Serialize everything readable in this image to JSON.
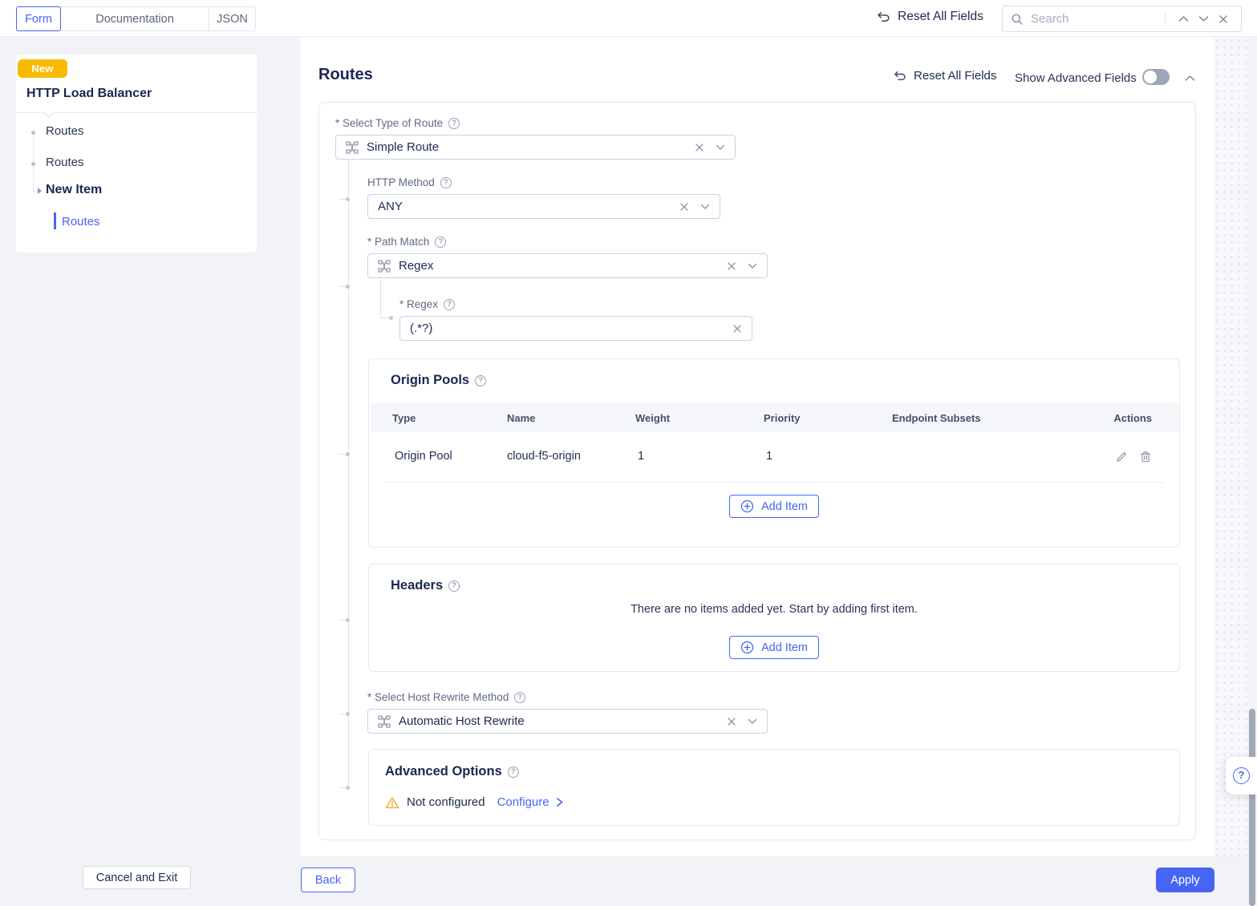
{
  "header": {
    "tabs": {
      "form": "Form",
      "documentation": "Documentation",
      "json": "JSON"
    },
    "reset_all_label": "Reset All Fields",
    "search_placeholder": "Search"
  },
  "sidebar": {
    "badge": "New",
    "title": "HTTP Load Balancer",
    "items": [
      {
        "label": "Routes"
      },
      {
        "label": "Routes"
      },
      {
        "label": "New Item"
      },
      {
        "label": "Routes"
      }
    ]
  },
  "main": {
    "title": "Routes",
    "reset_all_label": "Reset All Fields",
    "advanced_toggle_label": "Show Advanced Fields",
    "route_type": {
      "label": "* Select Type of Route",
      "value": "Simple Route"
    },
    "http_method": {
      "label": "HTTP Method",
      "value": "ANY"
    },
    "path_match": {
      "label": "* Path Match",
      "value": "Regex"
    },
    "regex": {
      "label": "* Regex",
      "value": "(.*?)"
    },
    "origin_pools": {
      "title": "Origin Pools",
      "columns": [
        "Type",
        "Name",
        "Weight",
        "Priority",
        "Endpoint Subsets",
        "Actions"
      ],
      "rows": [
        {
          "type": "Origin Pool",
          "name": "cloud-f5-origin",
          "weight": "1",
          "priority": "1",
          "endpoint_subsets": ""
        }
      ],
      "add_item_label": "Add Item"
    },
    "headers_section": {
      "title": "Headers",
      "empty_text": "There are no items added yet. Start by adding first item.",
      "add_item_label": "Add Item"
    },
    "host_rewrite": {
      "label": "* Select Host Rewrite Method",
      "value": "Automatic Host Rewrite"
    },
    "advanced_options": {
      "title": "Advanced Options",
      "status": "Not configured",
      "configure_label": "Configure"
    }
  },
  "footer": {
    "cancel": "Cancel and Exit",
    "back": "Back",
    "apply": "Apply"
  },
  "colors": {
    "accent": "#4765f4",
    "badge": "#f8ba00",
    "warning": "#efae18",
    "heading": "#1b2752"
  }
}
